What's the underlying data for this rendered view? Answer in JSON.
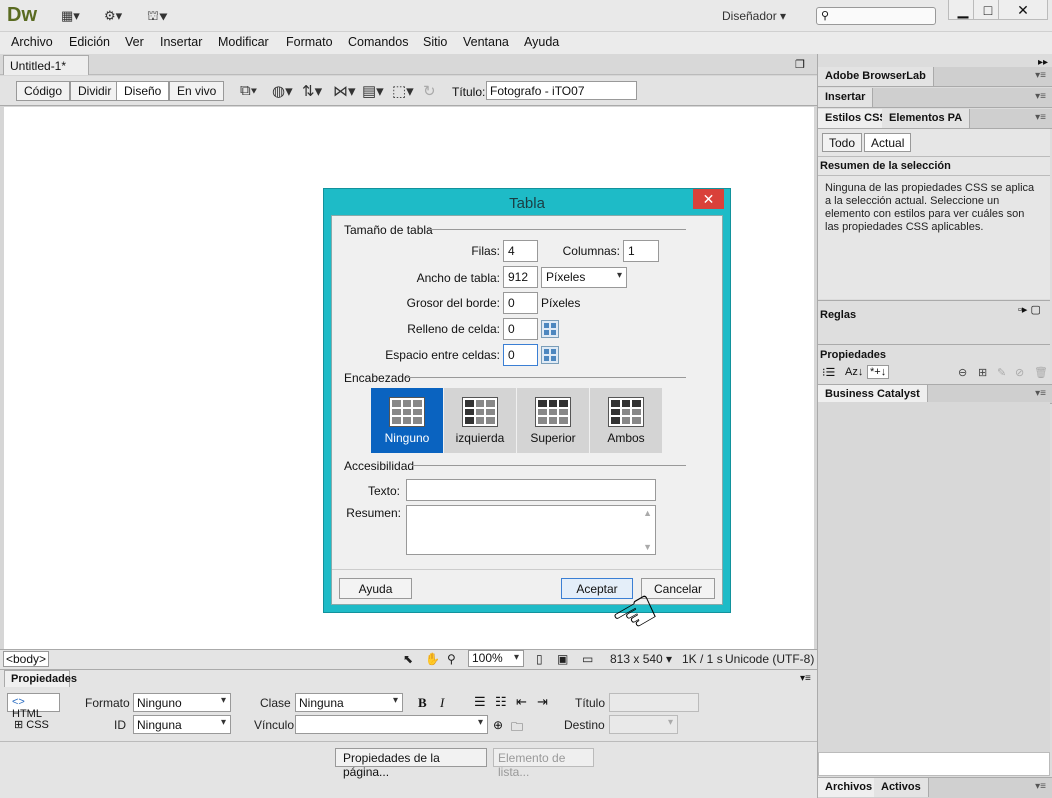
{
  "app": {
    "logo": "Dw",
    "workspace": "Diseñador"
  },
  "menu": [
    "Archivo",
    "Edición",
    "Ver",
    "Insertar",
    "Modificar",
    "Formato",
    "Comandos",
    "Sitio",
    "Ventana",
    "Ayuda"
  ],
  "document": {
    "tab": "Untitled-1*",
    "views": [
      "Código",
      "Dividir",
      "Diseño",
      "En vivo"
    ],
    "title_label": "Título:",
    "title_value": "Fotografo - iTO07"
  },
  "status": {
    "tag": "<body>",
    "zoom": "100%",
    "size": "813 x 540",
    "speed": "1K / 1 s",
    "encoding": "Unicode (UTF-8)"
  },
  "properties": {
    "tab": "Propiedades",
    "html_btn": "HTML",
    "css_btn": "CSS",
    "formato_label": "Formato",
    "formato_value": "Ninguno",
    "id_label": "ID",
    "id_value": "Ninguna",
    "clase_label": "Clase",
    "clase_value": "Ninguna",
    "vinculo_label": "Vínculo",
    "titulo_label": "Título",
    "destino_label": "Destino",
    "page_props_btn": "Propiedades de la página...",
    "list_item_btn": "Elemento de lista..."
  },
  "panels": {
    "browserlab": "Adobe BrowserLab",
    "insertar": "Insertar",
    "estilos_tab": "Estilos CSS",
    "elementos_tab": "Elementos PA",
    "todo": "Todo",
    "actual": "Actual",
    "resumen_title": "Resumen de la selección",
    "resumen_text": "Ninguna de las propiedades CSS se aplica a la selección actual.  Seleccione un elemento con estilos para ver cuáles son las propiedades CSS aplicables.",
    "reglas": "Reglas",
    "propiedades": "Propiedades",
    "business_catalyst": "Business Catalyst",
    "archivos": "Archivos",
    "activos": "Activos"
  },
  "dialog": {
    "title": "Tabla",
    "close": "✕",
    "tamano_section": "Tamaño de tabla",
    "filas_label": "Filas:",
    "filas_value": "4",
    "columnas_label": "Columnas:",
    "columnas_value": "1",
    "ancho_label": "Ancho de tabla:",
    "ancho_value": "912",
    "ancho_unit": "Píxeles",
    "grosor_label": "Grosor del borde:",
    "grosor_value": "0",
    "grosor_unit": "Píxeles",
    "relleno_label": "Relleno de celda:",
    "relleno_value": "0",
    "espacio_label": "Espacio entre celdas:",
    "espacio_value": "0",
    "encabezado_section": "Encabezado",
    "headers": [
      "Ninguno",
      "izquierda",
      "Superior",
      "Ambos"
    ],
    "accesibilidad_section": "Accesibilidad",
    "texto_label": "Texto:",
    "resumen_label": "Resumen:",
    "ayuda_btn": "Ayuda",
    "aceptar_btn": "Aceptar",
    "cancelar_btn": "Cancelar"
  }
}
